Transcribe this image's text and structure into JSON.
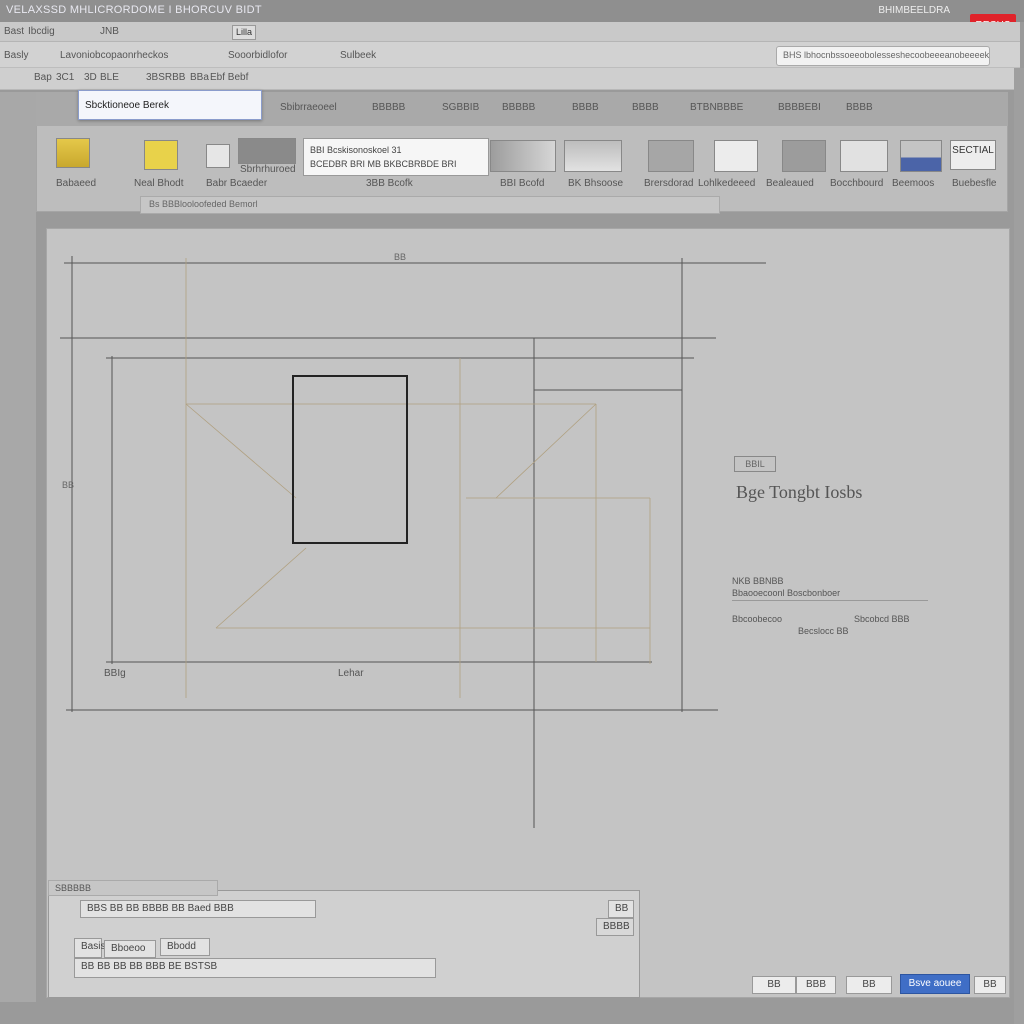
{
  "window": {
    "title": "VELAXSSD MHLICRORDOME I BHORCUV BIDT",
    "title_right": "BHIMBEELDRA",
    "close_label": "RECHS"
  },
  "toolbar1": {
    "items": [
      "Bast",
      "Ibcdig",
      "JNB"
    ],
    "button": "Lilla"
  },
  "toolbar2": {
    "items": [
      "Basly",
      "Lavoniobcopaonrheckos",
      "Sooorbidlofor",
      "Sulbeek"
    ],
    "search_text": "BHS lbhocnbssoeeobolesseshecoobeeeanobeeeekocseoeeeess"
  },
  "toolbar3": {
    "items": [
      "Bap",
      "3C1",
      "3D",
      "BLE",
      "3BSRBB",
      "BBa",
      "Ebf Bebf"
    ]
  },
  "ribbon": {
    "popup_label": "Sbcktioneoe Berek",
    "tabs": [
      "Sbibrraeoeel",
      "BBBBB",
      "SGBBIB",
      "BBBBB",
      "BBBB",
      "BBBB",
      "BTBNBBBE",
      "BBBBEBI",
      "BBBB"
    ],
    "labels": [
      "Babaeed",
      "Neal Bhodt",
      "Babr Bcaeder",
      "Sbrhrhuroed",
      "3BB Bcofk",
      "BBI Bcofd",
      "BK Bhsoose",
      "Brersdorad",
      "Lohlkedeeed",
      "Bealeaued",
      "Bocchbourd",
      "Beemoos",
      "Buebesfle"
    ],
    "font_lines": [
      "BBI Bcskisonoskoel 31",
      "BCEDBR BRI MB BKBCBRBDE BRI"
    ],
    "footer": "Bs BBBlooloofeded Bemorl",
    "section_label": "SECTIAL"
  },
  "drawing": {
    "top_dim": "BB",
    "left_dim": "BB",
    "bottom_label": "Lehar",
    "bottom_left": "BBIg"
  },
  "side_panel": {
    "box": "BBIL",
    "heading": "Bge Tongbt Iosbs",
    "sub1": "NKB BBNBB",
    "sub2": "Bbaooecoonl Boscbonboer",
    "row1": "Bbcoobecoo",
    "row2": "Becslocc BB",
    "row3": "Sbcobcd BBB"
  },
  "bottom_panel": {
    "header": "SBBBBB",
    "row1": "BBS BB BB BBBB BB Baed BBB",
    "row1_right": "BB",
    "row2_right": "BBBB",
    "tab1": "Basis",
    "tab2": "Bboeoo",
    "tab3": "Bbodd",
    "row3": "BB BB BB BB BBB BE BSTSB"
  },
  "dialog_buttons": {
    "b1": "BB",
    "b2": "BBB",
    "b3": "BB",
    "primary": "Bsve aouee",
    "b4": "BB"
  }
}
